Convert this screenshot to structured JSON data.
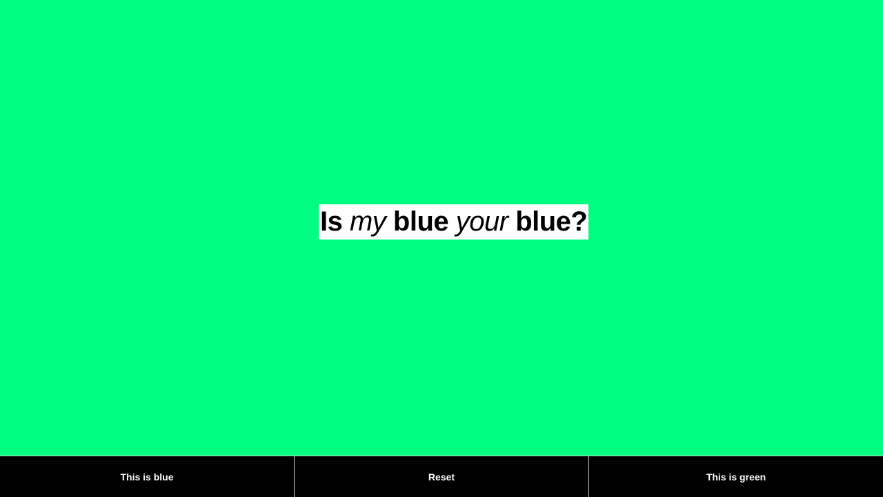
{
  "colors": {
    "background": "#00ff80",
    "title_background": "#ffffff",
    "title_text": "#000000",
    "button_background": "#000000",
    "button_text": "#ffffff",
    "divider": "#cccccc"
  },
  "title": {
    "part1": "Is ",
    "part2": "my",
    "part3": " blue ",
    "part4": "your",
    "part5": " blue?"
  },
  "buttons": {
    "blue_label": "This is blue",
    "reset_label": "Reset",
    "green_label": "This is green"
  }
}
